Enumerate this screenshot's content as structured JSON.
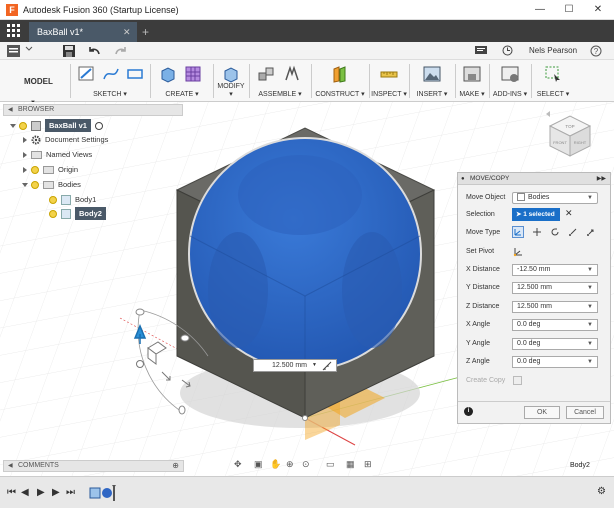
{
  "window": {
    "title": "Autodesk Fusion 360 (Startup License)",
    "logo": "F",
    "minimize": "—",
    "maximize": "☐",
    "close": "✕"
  },
  "tabs": {
    "active_label": "BaxBall v1*",
    "close_glyph": "✕",
    "add_glyph": "+"
  },
  "qab": {
    "user": "Nels Pearson",
    "help": "?"
  },
  "toolbar": {
    "workspace": "MODEL",
    "groups": [
      {
        "label": "SKETCH ▾"
      },
      {
        "label": "CREATE ▾"
      },
      {
        "label": "MODIFY ▾"
      },
      {
        "label": "ASSEMBLE ▾"
      },
      {
        "label": "CONSTRUCT ▾"
      },
      {
        "label": "INSPECT ▾"
      },
      {
        "label": "INSERT ▾"
      },
      {
        "label": "MAKE ▾"
      },
      {
        "label": "ADD-INS ▾"
      },
      {
        "label": "SELECT ▾"
      }
    ]
  },
  "browser": {
    "title": "BROWSER",
    "root": "BaxBall v1",
    "items": [
      {
        "label": "Document Settings"
      },
      {
        "label": "Named Views"
      },
      {
        "label": "Origin"
      },
      {
        "label": "Bodies"
      },
      {
        "label": "Body1"
      },
      {
        "label": "Body2"
      }
    ]
  },
  "viewcube": {
    "front": "FRONT",
    "right": "RIGHT",
    "top": "TOP"
  },
  "move_copy": {
    "title": "MOVE/COPY",
    "move_object_label": "Move Object",
    "move_object_value": "Bodies",
    "selection_label": "Selection",
    "selection_value": "1 selected",
    "move_type_label": "Move Type",
    "set_pivot_label": "Set Pivot",
    "x_distance_label": "X Distance",
    "x_distance_value": "-12.50 mm",
    "y_distance_label": "Y Distance",
    "y_distance_value": "12.500 mm",
    "z_distance_label": "Z Distance",
    "z_distance_value": "12.500 mm",
    "x_angle_label": "X Angle",
    "x_angle_value": "0.0 deg",
    "y_angle_label": "Y Angle",
    "y_angle_value": "0.0 deg",
    "z_angle_label": "Z Angle",
    "z_angle_value": "0.0 deg",
    "create_copy_label": "Create Copy",
    "ok_label": "OK",
    "cancel_label": "Cancel"
  },
  "dimension_input": {
    "value": "12.500 mm"
  },
  "comments": {
    "title": "COMMENTS"
  },
  "status": {
    "selected_body": "Body2"
  },
  "colors": {
    "sphere_blue": "#2f66c4",
    "cube_gray": "#5b5b55",
    "tab_bar": "#3c3c3c",
    "accent_selection": "#1a6fc8",
    "pivot_orange": "#f3a51e"
  }
}
